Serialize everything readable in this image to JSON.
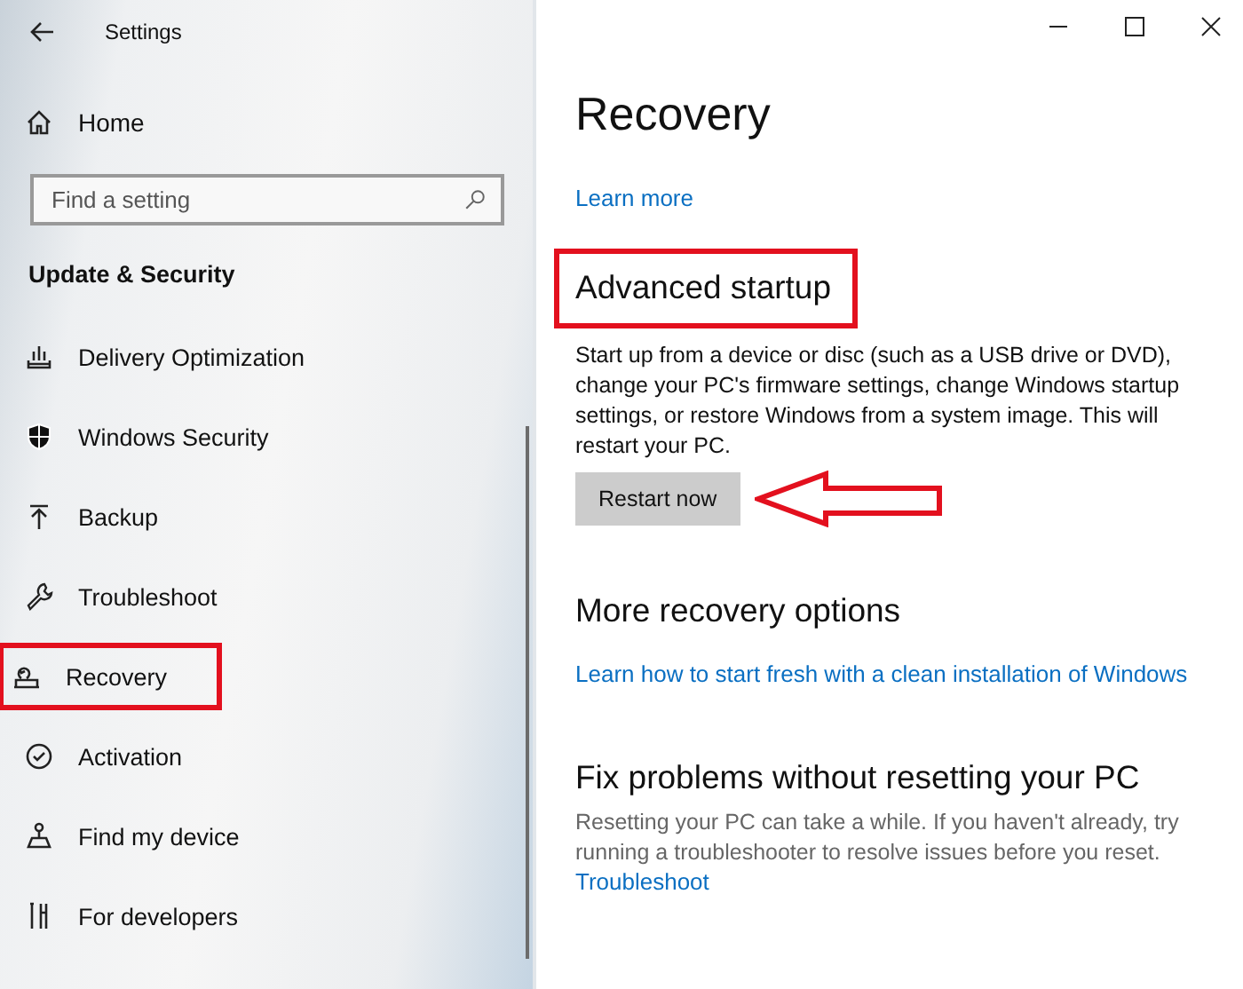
{
  "window": {
    "title": "Settings"
  },
  "sidebar": {
    "home": "Home",
    "search": {
      "placeholder": "Find a setting"
    },
    "heading": "Update & Security",
    "items": [
      {
        "label": "Delivery Optimization",
        "kind": "delivery",
        "selected": false
      },
      {
        "label": "Windows Security",
        "kind": "shield",
        "selected": false
      },
      {
        "label": "Backup",
        "kind": "backup",
        "selected": false
      },
      {
        "label": "Troubleshoot",
        "kind": "wrench",
        "selected": false
      },
      {
        "label": "Recovery",
        "kind": "recovery",
        "selected": true
      },
      {
        "label": "Activation",
        "kind": "check",
        "selected": false
      },
      {
        "label": "Find my device",
        "kind": "person",
        "selected": false
      },
      {
        "label": "For developers",
        "kind": "dev",
        "selected": false
      }
    ]
  },
  "page": {
    "title": "Recovery",
    "link": "Learn more",
    "sections": [
      {
        "kind": "action",
        "heading": "Advanced startup",
        "highlighted": true,
        "text": "Start up from a device or disc (such as a USB drive or DVD), change your PC's firmware settings, change Windows startup settings, or restore Windows from a system image. This will restart your PC.",
        "button": "Restart now",
        "arrow": true
      },
      {
        "kind": "link",
        "heading": "More recovery options",
        "link": "Learn how to start fresh with a clean installation of Windows"
      },
      {
        "kind": "info",
        "heading": "Fix problems without resetting your PC",
        "text": "Resetting your PC can take a while. If you haven't already, try running a troubleshooter to resolve issues before you reset.",
        "link": "Troubleshoot"
      }
    ]
  }
}
